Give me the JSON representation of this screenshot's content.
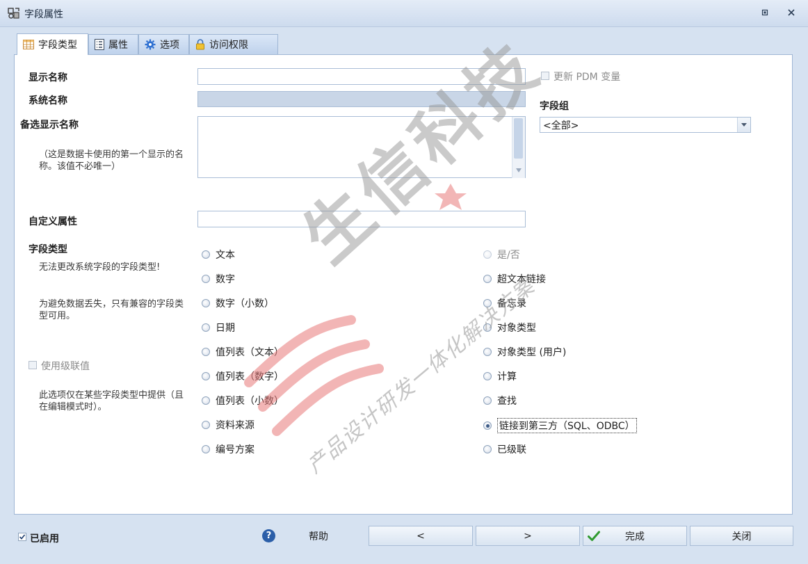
{
  "window": {
    "title": "字段属性"
  },
  "tabs": [
    {
      "label": "字段类型",
      "icon": "table-icon",
      "active": true
    },
    {
      "label": "属性",
      "icon": "properties-icon",
      "active": false
    },
    {
      "label": "选项",
      "icon": "gear-icon",
      "active": false
    },
    {
      "label": "访问权限",
      "icon": "lock-icon",
      "active": false
    }
  ],
  "form": {
    "display_name_label": "显示名称",
    "display_name_value": "",
    "system_name_label": "系统名称",
    "system_name_value": "",
    "alt_display_name_label": "备选显示名称",
    "alt_display_name_hint": "（这是数据卡使用的第一个显示的名称。该值不必唯一）",
    "alt_display_name_value": "",
    "custom_property_label": "自定义属性",
    "custom_property_value": "",
    "field_type_label": "字段类型",
    "field_type_hint1": "无法更改系统字段的字段类型!",
    "field_type_hint2": "为避免数据丢失，只有兼容的字段类型可用。",
    "cascade_label": "使用级联值",
    "cascade_checked": false,
    "cascade_hint": "此选项仅在某些字段类型中提供（且在编辑模式时）。",
    "update_pdm_label": "更新 PDM 变量",
    "update_pdm_checked": false,
    "field_group_label": "字段组",
    "field_group_value": "<全部>"
  },
  "field_types_left": [
    {
      "label": "文本",
      "selected": false,
      "disabled": false
    },
    {
      "label": "数字",
      "selected": false,
      "disabled": false
    },
    {
      "label": "数字（小数）",
      "selected": false,
      "disabled": false
    },
    {
      "label": "日期",
      "selected": false,
      "disabled": false
    },
    {
      "label": "值列表（文本）",
      "selected": false,
      "disabled": false
    },
    {
      "label": "值列表（数字）",
      "selected": false,
      "disabled": false
    },
    {
      "label": "值列表（小数）",
      "selected": false,
      "disabled": false
    },
    {
      "label": "资料来源",
      "selected": false,
      "disabled": false
    },
    {
      "label": "编号方案",
      "selected": false,
      "disabled": false
    }
  ],
  "field_types_right": [
    {
      "label": "是/否",
      "selected": false,
      "disabled": true
    },
    {
      "label": "超文本链接",
      "selected": false,
      "disabled": false
    },
    {
      "label": "备忘录",
      "selected": false,
      "disabled": false
    },
    {
      "label": "对象类型",
      "selected": false,
      "disabled": false
    },
    {
      "label": "对象类型 (用户)",
      "selected": false,
      "disabled": false
    },
    {
      "label": "计算",
      "selected": false,
      "disabled": false
    },
    {
      "label": "查找",
      "selected": false,
      "disabled": false
    },
    {
      "label": "链接到第三方（SQL、ODBC）",
      "selected": true,
      "disabled": false
    },
    {
      "label": "已级联",
      "selected": false,
      "disabled": false
    }
  ],
  "footer": {
    "enabled_label": "已启用",
    "enabled_checked": true,
    "help_label": "帮助",
    "prev_label": "<",
    "next_label": ">",
    "finish_label": "完成",
    "close_label": "关闭"
  },
  "watermark": {
    "brand": "生信科技",
    "slogan": "产品设计研发一体化解决方案"
  },
  "colors": {
    "window_bg": "#d6e2f1",
    "panel_border": "#9fb6d4",
    "accent_red": "#e34a4a",
    "check_green": "#2f9a2f",
    "help_blue": "#2b5ea8"
  }
}
